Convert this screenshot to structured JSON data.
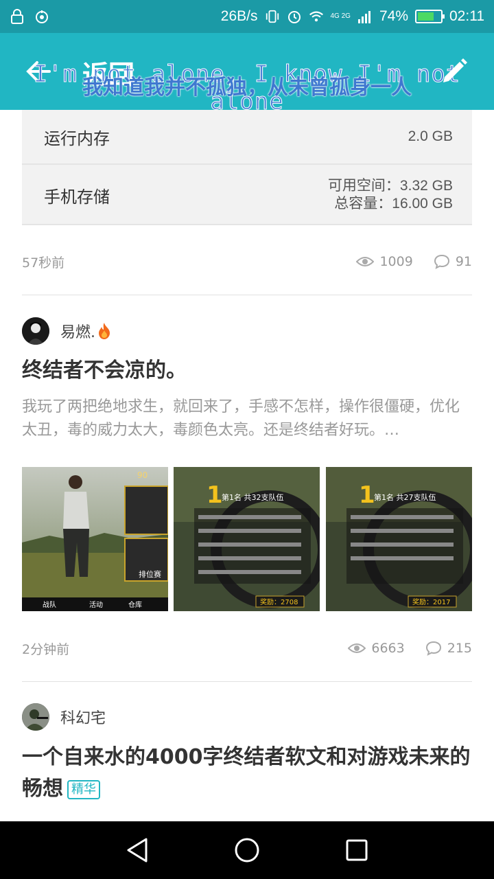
{
  "status_bar": {
    "net_speed": "26B/s",
    "network": "4G 2G",
    "battery_percent": "74%",
    "battery_level": 0.74,
    "time": "02:11"
  },
  "app_bar": {
    "back_label": "返回",
    "lyric_en": "I'm not alone, I know I'm not alone",
    "lyric_zh": "我知道我并不孤独，从未曾孤身一人"
  },
  "spec_card": {
    "ram_label": "运行内存",
    "ram_value": "2.0 GB",
    "storage_label": "手机存储",
    "storage_available": "可用空间：3.32 GB",
    "storage_total": "总容量：16.00 GB"
  },
  "post0_meta": {
    "time": "57秒前",
    "views": "1009",
    "comments": "91"
  },
  "post1": {
    "author": "易燃.",
    "title": "终结者不会凉的。",
    "excerpt": "我玩了两把绝地求生，就回来了，手感不怎样，操作很僵硬，优化太丑，毒的威力太大，毒颜色太亮。还是终结者好玩。…",
    "time": "2分钟前",
    "views": "6663",
    "comments": "215",
    "thumb1": {
      "team": "战队",
      "activity": "活动",
      "warehouse": "仓库",
      "mode": "排位赛",
      "level": "90"
    },
    "thumb2": {
      "rank": "第1名 共32支队伍",
      "reward": "奖励：2708"
    },
    "thumb3": {
      "rank": "第1名 共27支队伍",
      "reward": "奖励：2017"
    }
  },
  "post2": {
    "author": "科幻宅",
    "title": "一个自来水的4000字终结者软文和对游戏未来的畅想",
    "badge": "精华"
  },
  "colors": {
    "accent": "#21b6c3",
    "status": "#1b9aa6"
  }
}
